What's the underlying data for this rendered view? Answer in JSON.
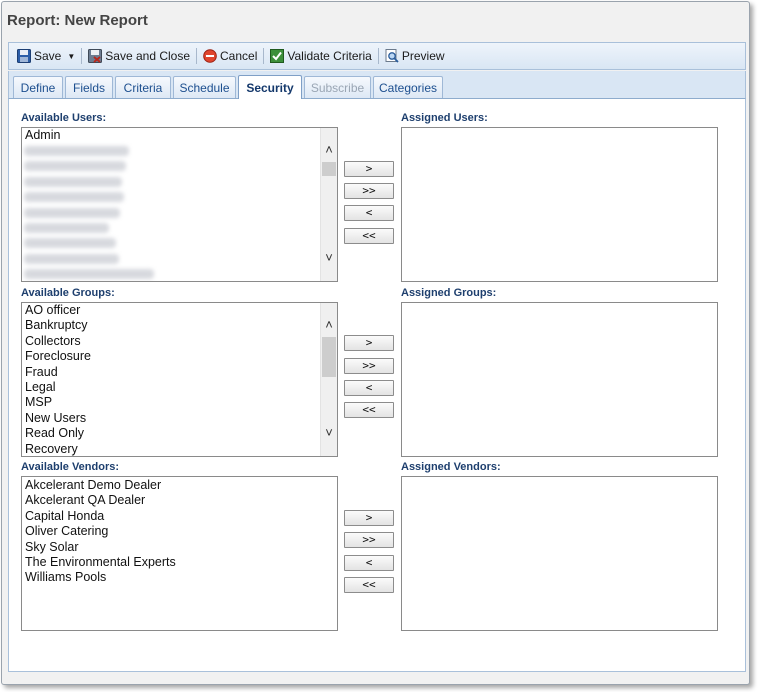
{
  "window": {
    "title": "Report: New Report"
  },
  "toolbar": {
    "save": "Save",
    "save_and_close": "Save and Close",
    "cancel": "Cancel",
    "validate_criteria": "Validate Criteria",
    "preview": "Preview"
  },
  "tabs": [
    {
      "label": "Define"
    },
    {
      "label": "Fields"
    },
    {
      "label": "Criteria"
    },
    {
      "label": "Schedule"
    },
    {
      "label": "Security"
    },
    {
      "label": "Subscribe"
    },
    {
      "label": "Categories"
    }
  ],
  "users": {
    "available_label": "Available Users:",
    "assigned_label": "Assigned Users:",
    "items": [
      "Admin"
    ]
  },
  "groups": {
    "available_label": "Available Groups:",
    "assigned_label": "Assigned Groups:",
    "items": [
      "AO officer",
      "Bankruptcy",
      "Collectors",
      "Foreclosure",
      "Fraud",
      "Legal",
      "MSP",
      "New Users",
      "Read Only",
      "Recovery"
    ]
  },
  "vendors": {
    "available_label": "Available Vendors:",
    "assigned_label": "Assigned Vendors:",
    "items": [
      "Akcelerant Demo Dealer",
      "Akcelerant QA Dealer",
      "Capital Honda",
      "Oliver Catering",
      "Sky Solar",
      "The Environmental Experts",
      "Williams Pools"
    ]
  },
  "move_buttons": {
    "add": ">",
    "add_all": ">>",
    "remove": "<",
    "remove_all": "<<"
  },
  "colors": {
    "label_blue": "#1e3f6e",
    "tab_text": "#1d4f8f",
    "toolbar_bg": "#d9e6f4"
  }
}
